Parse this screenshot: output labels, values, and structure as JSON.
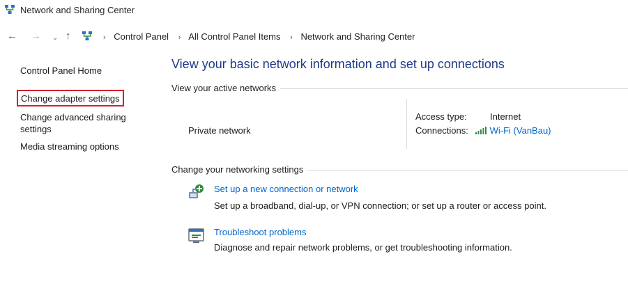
{
  "window": {
    "title": "Network and Sharing Center"
  },
  "nav": {
    "back": "←",
    "forward": "→",
    "recent": "⌄",
    "up": "↑"
  },
  "breadcrumb": {
    "items": [
      "Control Panel",
      "All Control Panel Items",
      "Network and Sharing Center"
    ],
    "separator": "›"
  },
  "sidebar": {
    "home": "Control Panel Home",
    "adapter": "Change adapter settings",
    "advanced": "Change advanced sharing settings",
    "media": "Media streaming options"
  },
  "main": {
    "title": "View your basic network information and set up connections",
    "active_networks_label": "View your active networks",
    "network": {
      "name": "Private network",
      "access_type_label": "Access type:",
      "access_type_value": "Internet",
      "connections_label": "Connections:",
      "connection_value": "Wi-Fi (VanBau)"
    },
    "change_settings_label": "Change your networking settings",
    "tasks": [
      {
        "link": "Set up a new connection or network",
        "desc": "Set up a broadband, dial-up, or VPN connection; or set up a router or access point."
      },
      {
        "link": "Troubleshoot problems",
        "desc": "Diagnose and repair network problems, or get troubleshooting information."
      }
    ]
  },
  "colors": {
    "link": "#0066cc",
    "title": "#1e3a8a",
    "highlight_border": "#d1212c",
    "wifi": "#2e8b3a"
  }
}
